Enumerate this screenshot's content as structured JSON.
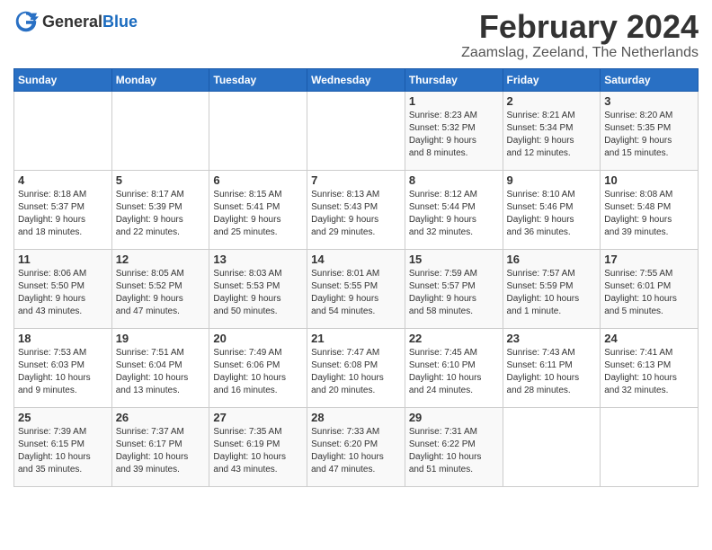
{
  "logo": {
    "general": "General",
    "blue": "Blue"
  },
  "title": "February 2024",
  "location": "Zaamslag, Zeeland, The Netherlands",
  "headers": [
    "Sunday",
    "Monday",
    "Tuesday",
    "Wednesday",
    "Thursday",
    "Friday",
    "Saturday"
  ],
  "weeks": [
    [
      {
        "day": "",
        "info": ""
      },
      {
        "day": "",
        "info": ""
      },
      {
        "day": "",
        "info": ""
      },
      {
        "day": "",
        "info": ""
      },
      {
        "day": "1",
        "info": "Sunrise: 8:23 AM\nSunset: 5:32 PM\nDaylight: 9 hours\nand 8 minutes."
      },
      {
        "day": "2",
        "info": "Sunrise: 8:21 AM\nSunset: 5:34 PM\nDaylight: 9 hours\nand 12 minutes."
      },
      {
        "day": "3",
        "info": "Sunrise: 8:20 AM\nSunset: 5:35 PM\nDaylight: 9 hours\nand 15 minutes."
      }
    ],
    [
      {
        "day": "4",
        "info": "Sunrise: 8:18 AM\nSunset: 5:37 PM\nDaylight: 9 hours\nand 18 minutes."
      },
      {
        "day": "5",
        "info": "Sunrise: 8:17 AM\nSunset: 5:39 PM\nDaylight: 9 hours\nand 22 minutes."
      },
      {
        "day": "6",
        "info": "Sunrise: 8:15 AM\nSunset: 5:41 PM\nDaylight: 9 hours\nand 25 minutes."
      },
      {
        "day": "7",
        "info": "Sunrise: 8:13 AM\nSunset: 5:43 PM\nDaylight: 9 hours\nand 29 minutes."
      },
      {
        "day": "8",
        "info": "Sunrise: 8:12 AM\nSunset: 5:44 PM\nDaylight: 9 hours\nand 32 minutes."
      },
      {
        "day": "9",
        "info": "Sunrise: 8:10 AM\nSunset: 5:46 PM\nDaylight: 9 hours\nand 36 minutes."
      },
      {
        "day": "10",
        "info": "Sunrise: 8:08 AM\nSunset: 5:48 PM\nDaylight: 9 hours\nand 39 minutes."
      }
    ],
    [
      {
        "day": "11",
        "info": "Sunrise: 8:06 AM\nSunset: 5:50 PM\nDaylight: 9 hours\nand 43 minutes."
      },
      {
        "day": "12",
        "info": "Sunrise: 8:05 AM\nSunset: 5:52 PM\nDaylight: 9 hours\nand 47 minutes."
      },
      {
        "day": "13",
        "info": "Sunrise: 8:03 AM\nSunset: 5:53 PM\nDaylight: 9 hours\nand 50 minutes."
      },
      {
        "day": "14",
        "info": "Sunrise: 8:01 AM\nSunset: 5:55 PM\nDaylight: 9 hours\nand 54 minutes."
      },
      {
        "day": "15",
        "info": "Sunrise: 7:59 AM\nSunset: 5:57 PM\nDaylight: 9 hours\nand 58 minutes."
      },
      {
        "day": "16",
        "info": "Sunrise: 7:57 AM\nSunset: 5:59 PM\nDaylight: 10 hours\nand 1 minute."
      },
      {
        "day": "17",
        "info": "Sunrise: 7:55 AM\nSunset: 6:01 PM\nDaylight: 10 hours\nand 5 minutes."
      }
    ],
    [
      {
        "day": "18",
        "info": "Sunrise: 7:53 AM\nSunset: 6:03 PM\nDaylight: 10 hours\nand 9 minutes."
      },
      {
        "day": "19",
        "info": "Sunrise: 7:51 AM\nSunset: 6:04 PM\nDaylight: 10 hours\nand 13 minutes."
      },
      {
        "day": "20",
        "info": "Sunrise: 7:49 AM\nSunset: 6:06 PM\nDaylight: 10 hours\nand 16 minutes."
      },
      {
        "day": "21",
        "info": "Sunrise: 7:47 AM\nSunset: 6:08 PM\nDaylight: 10 hours\nand 20 minutes."
      },
      {
        "day": "22",
        "info": "Sunrise: 7:45 AM\nSunset: 6:10 PM\nDaylight: 10 hours\nand 24 minutes."
      },
      {
        "day": "23",
        "info": "Sunrise: 7:43 AM\nSunset: 6:11 PM\nDaylight: 10 hours\nand 28 minutes."
      },
      {
        "day": "24",
        "info": "Sunrise: 7:41 AM\nSunset: 6:13 PM\nDaylight: 10 hours\nand 32 minutes."
      }
    ],
    [
      {
        "day": "25",
        "info": "Sunrise: 7:39 AM\nSunset: 6:15 PM\nDaylight: 10 hours\nand 35 minutes."
      },
      {
        "day": "26",
        "info": "Sunrise: 7:37 AM\nSunset: 6:17 PM\nDaylight: 10 hours\nand 39 minutes."
      },
      {
        "day": "27",
        "info": "Sunrise: 7:35 AM\nSunset: 6:19 PM\nDaylight: 10 hours\nand 43 minutes."
      },
      {
        "day": "28",
        "info": "Sunrise: 7:33 AM\nSunset: 6:20 PM\nDaylight: 10 hours\nand 47 minutes."
      },
      {
        "day": "29",
        "info": "Sunrise: 7:31 AM\nSunset: 6:22 PM\nDaylight: 10 hours\nand 51 minutes."
      },
      {
        "day": "",
        "info": ""
      },
      {
        "day": "",
        "info": ""
      }
    ]
  ]
}
